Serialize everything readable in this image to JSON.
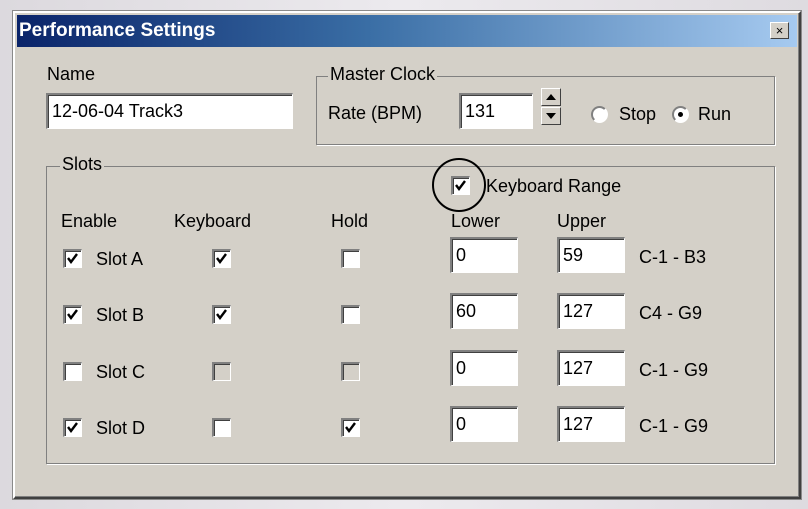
{
  "window": {
    "title": "Performance Settings",
    "close_glyph": "×"
  },
  "name_section": {
    "label": "Name",
    "value": "12-06-04 Track3"
  },
  "master_clock": {
    "legend": "Master Clock",
    "rate_label": "Rate (BPM)",
    "rate_value": "131",
    "stop_label": "Stop",
    "run_label": "Run",
    "selected": "Run"
  },
  "slots": {
    "legend": "Slots",
    "keyboard_range_label": "Keyboard Range",
    "keyboard_range_checked": true,
    "headers": {
      "enable": "Enable",
      "keyboard": "Keyboard",
      "hold": "Hold",
      "lower": "Lower",
      "upper": "Upper"
    },
    "rows": [
      {
        "label": "Slot A",
        "enabled": true,
        "keyboard": true,
        "keyboard_disabled": false,
        "hold": false,
        "hold_disabled": false,
        "lower": "0",
        "upper": "59",
        "range": "C-1 - B3"
      },
      {
        "label": "Slot B",
        "enabled": true,
        "keyboard": true,
        "keyboard_disabled": false,
        "hold": false,
        "hold_disabled": false,
        "lower": "60",
        "upper": "127",
        "range": "C4 - G9"
      },
      {
        "label": "Slot C",
        "enabled": false,
        "keyboard": false,
        "keyboard_disabled": true,
        "hold": false,
        "hold_disabled": true,
        "lower": "0",
        "upper": "127",
        "range": "C-1 - G9"
      },
      {
        "label": "Slot D",
        "enabled": true,
        "keyboard": false,
        "keyboard_disabled": false,
        "hold": true,
        "hold_disabled": false,
        "lower": "0",
        "upper": "127",
        "range": "C-1 - G9"
      }
    ]
  },
  "icons": {
    "check": "check-icon",
    "spin_up": "arrow-up-icon",
    "spin_down": "arrow-down-icon",
    "close": "close-icon"
  }
}
